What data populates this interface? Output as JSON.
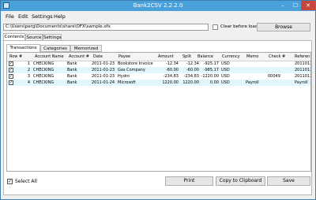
{
  "window": {
    "title": "Bank2CSV 2.2.2.0",
    "min": "–",
    "max": "☐",
    "close": "✕"
  },
  "menu": [
    "File",
    "Edit",
    "Settings",
    "Help"
  ],
  "path": {
    "value": "C:\\Users\\perg\\Documents\\share\\OFX\\sample.ofx",
    "clear_label": "Clear before load",
    "browse": "Browse"
  },
  "tabs": [
    "Contents",
    "Source",
    "Settings"
  ],
  "subtabs": [
    "Transactions (4)",
    "Categories (0)",
    "Memorized (0)"
  ],
  "grid": {
    "headers": [
      "Row #",
      "Account Name",
      "Account #",
      "Date",
      "Payee",
      "Amount",
      "Split",
      "Balance",
      "Currency",
      "Memo",
      "Check #",
      "Referen"
    ],
    "rows": [
      {
        "checked": "✓",
        "cells": [
          "1",
          "CHECKING",
          "Bank",
          "2011-01-23",
          "Bookstore Invoice",
          "-12.34",
          "-12.34",
          "-925.17",
          "USD",
          "",
          "",
          "2011012"
        ]
      },
      {
        "checked": "✓",
        "cells": [
          "2",
          "CHECKING",
          "Bank",
          "2011-01-23",
          "Gas Company",
          "-60.00",
          "-60.00",
          "-985.17",
          "USD",
          "",
          "",
          "2011012"
        ]
      },
      {
        "checked": "✓",
        "cells": [
          "3",
          "CHECKING",
          "Bank",
          "2011-01-23",
          "Hydro",
          "-234.83",
          "-234.83",
          "-1220.00",
          "USD",
          "",
          "00049",
          "2011012"
        ]
      },
      {
        "checked": "✓",
        "cells": [
          "4",
          "CHECKING",
          "Bank",
          "2011-01-24",
          "Microsoft",
          "1220.00",
          "1220.00",
          "0.00",
          "USD",
          "Payroll",
          "",
          "Payroll"
        ]
      }
    ]
  },
  "bottom": {
    "select_all": "Select All",
    "select_all_checked": "✓",
    "print": "Print",
    "copy": "Copy to Clipboard",
    "save": "Save"
  }
}
